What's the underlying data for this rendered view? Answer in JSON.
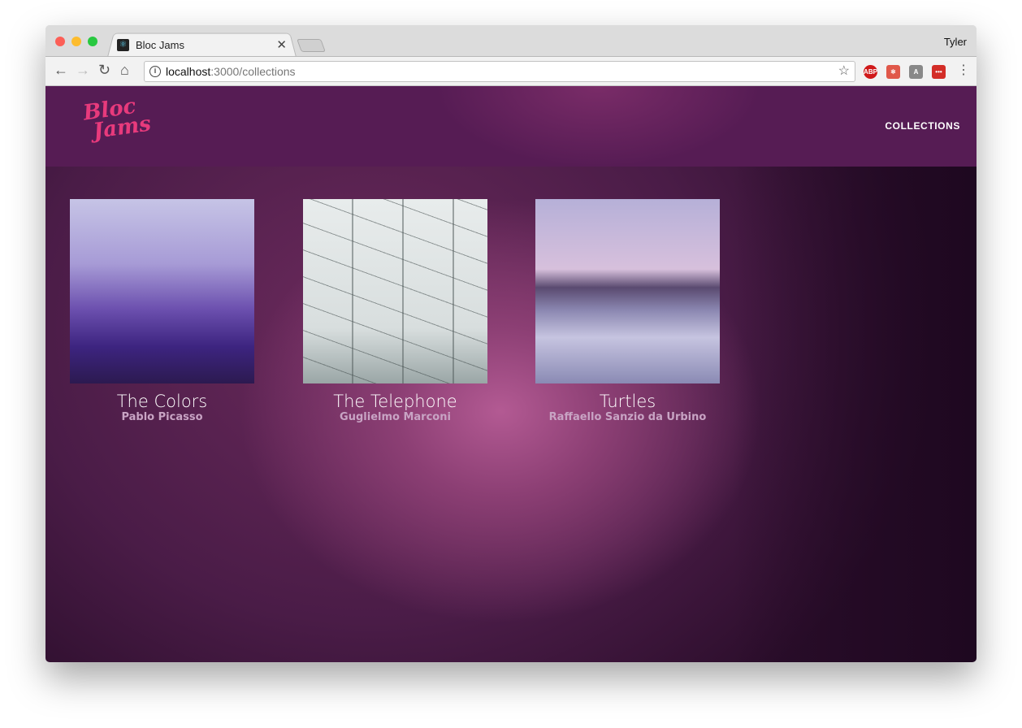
{
  "browser": {
    "tab_title": "Bloc Jams",
    "user": "Tyler",
    "url_host": "localhost",
    "url_path": ":3000/collections",
    "extensions": [
      "ABP",
      "react-devtools",
      "angular",
      "lastpass"
    ]
  },
  "app": {
    "logo_text": "Bloc Jams",
    "nav": {
      "collections": "COLLECTIONS"
    },
    "albums": [
      {
        "title": "The Colors",
        "artist": "Pablo Picasso"
      },
      {
        "title": "The Telephone",
        "artist": "Guglielmo Marconi"
      },
      {
        "title": "Turtles",
        "artist": "Raffaello Sanzio da Urbino"
      }
    ]
  },
  "colors": {
    "header": "#561c54",
    "logo": "#e83a7c",
    "accent_glow": "#b35a93"
  }
}
